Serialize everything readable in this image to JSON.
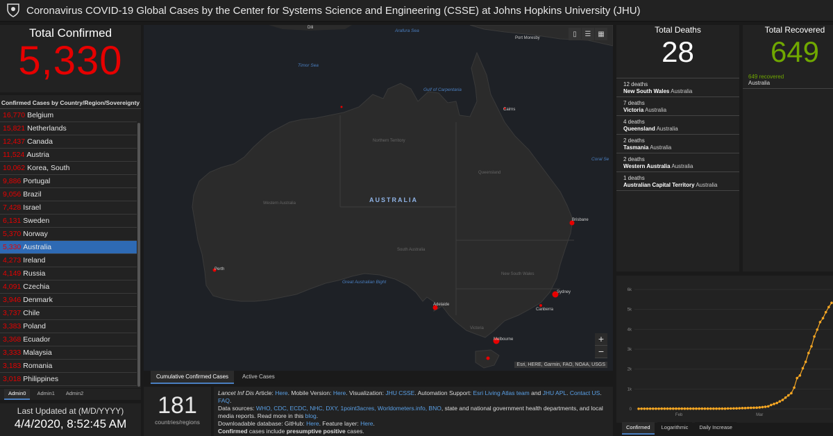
{
  "header": {
    "title": "Coronavirus COVID-19 Global Cases by the Center for Systems Science and Engineering (CSSE) at Johns Hopkins University (JHU)"
  },
  "confirmed": {
    "label": "Total Confirmed",
    "value": "5,330"
  },
  "list": {
    "header": "Confirmed Cases by Country/Region/Sovereignty",
    "rows": [
      {
        "n": "16,770",
        "c": "Belgium"
      },
      {
        "n": "15,821",
        "c": "Netherlands"
      },
      {
        "n": "12,437",
        "c": "Canada"
      },
      {
        "n": "11,524",
        "c": "Austria"
      },
      {
        "n": "10,062",
        "c": "Korea, South"
      },
      {
        "n": "9,886",
        "c": "Portugal"
      },
      {
        "n": "9,056",
        "c": "Brazil"
      },
      {
        "n": "7,428",
        "c": "Israel"
      },
      {
        "n": "6,131",
        "c": "Sweden"
      },
      {
        "n": "5,370",
        "c": "Norway"
      },
      {
        "n": "5,330",
        "c": "Australia"
      },
      {
        "n": "4,273",
        "c": "Ireland"
      },
      {
        "n": "4,149",
        "c": "Russia"
      },
      {
        "n": "4,091",
        "c": "Czechia"
      },
      {
        "n": "3,946",
        "c": "Denmark"
      },
      {
        "n": "3,737",
        "c": "Chile"
      },
      {
        "n": "3,383",
        "c": "Poland"
      },
      {
        "n": "3,368",
        "c": "Ecuador"
      },
      {
        "n": "3,333",
        "c": "Malaysia"
      },
      {
        "n": "3,183",
        "c": "Romania"
      },
      {
        "n": "3,018",
        "c": "Philippines"
      }
    ],
    "selected_index": 10
  },
  "admin_tabs": [
    "Admin0",
    "Admin1",
    "Admin2"
  ],
  "updated": {
    "label": "Last Updated at (M/D/YYYY)",
    "value": "4/4/2020, 8:52:45 AM"
  },
  "map": {
    "labels": {
      "country": "AUSTRALIA",
      "timor_sea": "Timor Sea",
      "arafura_sea": "Arafura Sea",
      "gulf": "Gulf of Carpentaria",
      "coral_sea": "Coral Se",
      "bight": "Great Australian Bight",
      "nt": "Northern Territory",
      "wa": "Western Australia",
      "sa": "South Australia",
      "qld": "Queensland",
      "nsw": "New South Wales",
      "vic": "Victoria",
      "darwin": "Dili",
      "port_moresby": "Port Moresby",
      "cairns": "Cairns",
      "brisbane": "Brisbane",
      "sydney": "Sydney",
      "canberra": "Canberra",
      "melbourne": "Melbourne",
      "adelaide": "Adelaide",
      "perth": "Perth"
    },
    "attribution": "Esri, HERE, Garmin, FAO, NOAA, USGS",
    "zoom_in": "+",
    "zoom_out": "−"
  },
  "map_tabs": [
    "Cumulative Confirmed Cases",
    "Active Cases"
  ],
  "countries": {
    "value": "181",
    "label": "countries/regions"
  },
  "info": {
    "l1a": "Lancet Inf Dis",
    "l1b": " Article: ",
    "here1": "Here",
    "l1c": ". Mobile Version: ",
    "here2": "Here",
    "l1d": ". Visualization: ",
    "jhu": "JHU CSSE",
    "l1e": ". Automation Support: ",
    "esri": "Esri Living Atlas team",
    "l1f": " and ",
    "jhu2": "JHU APL",
    "l1g": ". ",
    "contact": "Contact US",
    "l1h": ". ",
    "faq": "FAQ",
    "l1i": ".",
    "l2a": "Data sources: ",
    "sources": "WHO, CDC, ECDC, NHC, DXY, 1point3acres, Worldometers.info, BNO",
    "l2b": ", state and national government health departments, and local media reports.  Read more in this ",
    "blog": "blog",
    "l2c": ".",
    "l3a": "Downloadable database: GitHub: ",
    "here3": "Here",
    "l3b": ". Feature layer: ",
    "here4": "Here",
    "l3c": ".",
    "l4a": "Confirmed",
    "l4b": " cases include ",
    "l4c": "presumptive positive",
    "l4d": " cases."
  },
  "deaths": {
    "label": "Total Deaths",
    "value": "28",
    "rows": [
      {
        "count": "12 deaths",
        "region": "New South Wales",
        "country": "Australia"
      },
      {
        "count": "7 deaths",
        "region": "Victoria",
        "country": "Australia"
      },
      {
        "count": "4 deaths",
        "region": "Queensland",
        "country": "Australia"
      },
      {
        "count": "2 deaths",
        "region": "Tasmania",
        "country": "Australia"
      },
      {
        "count": "2 deaths",
        "region": "Western Australia",
        "country": "Australia"
      },
      {
        "count": "1 deaths",
        "region": "Australian Capital Territory",
        "country": "Australia"
      }
    ]
  },
  "recovered": {
    "label": "Total Recovered",
    "value": "649",
    "detail": "649 recovered",
    "country": "Australia"
  },
  "chart_tabs": [
    "Confirmed",
    "Logarithmic",
    "Daily Increase"
  ],
  "colors": {
    "confirmed": "#e60000",
    "recovered": "#70a800",
    "chart_line": "#f5a623",
    "selected": "#2e6ab4"
  },
  "chart_data": {
    "type": "line",
    "yticks": [
      "0",
      "1k",
      "2k",
      "3k",
      "4k",
      "5k",
      "6k"
    ],
    "xticks": [
      "Feb",
      "Mar"
    ],
    "ylim": [
      0,
      6000
    ],
    "values": [
      9,
      12,
      12,
      12,
      12,
      12,
      12,
      12,
      15,
      15,
      15,
      15,
      15,
      15,
      15,
      15,
      15,
      15,
      15,
      15,
      15,
      15,
      15,
      15,
      15,
      15,
      15,
      15,
      15,
      15,
      15,
      22,
      22,
      25,
      27,
      33,
      40,
      41,
      52,
      55,
      60,
      63,
      76,
      91,
      107,
      128,
      200,
      250,
      297,
      377,
      452,
      568,
      681,
      791,
      1071,
      1549,
      1682,
      2044,
      2364,
      2810,
      3143,
      3640,
      3984,
      4361,
      4559,
      4862,
      5116,
      5330
    ],
    "color": "#f5a623"
  }
}
